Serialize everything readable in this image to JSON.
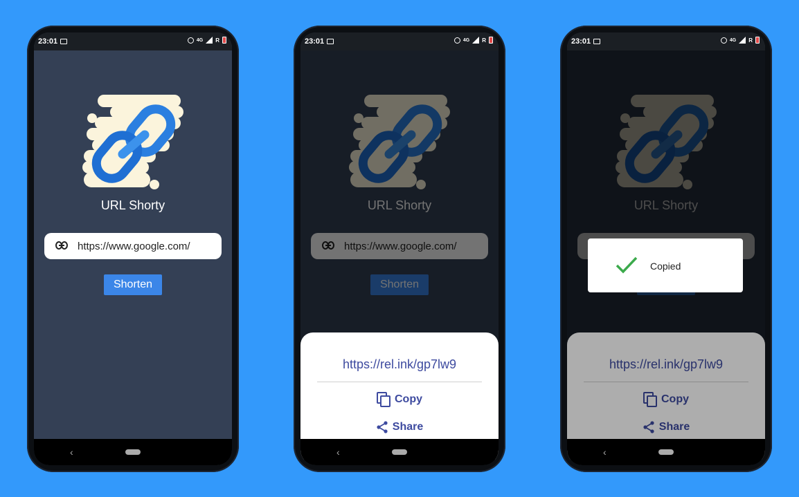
{
  "colors": {
    "background": "#3399fb",
    "app_bg": "#344055",
    "button": "#3b86e8",
    "accent_text": "#3d4a9f",
    "check": "#3caa4c"
  },
  "status_bar": {
    "time": "23:01",
    "network": "4G",
    "roaming": "R"
  },
  "app": {
    "title": "URL Shorty",
    "input_value": "https://www.google.com/",
    "shorten_label": "Shorten"
  },
  "sheet": {
    "short_url": "https://rel.ink/gp7lw9",
    "copy_label": "Copy",
    "share_label": "Share"
  },
  "toast": {
    "message": "Copied"
  },
  "icons": [
    "link-icon",
    "copy-icon",
    "share-icon",
    "check-icon",
    "back-icon",
    "home-icon"
  ]
}
